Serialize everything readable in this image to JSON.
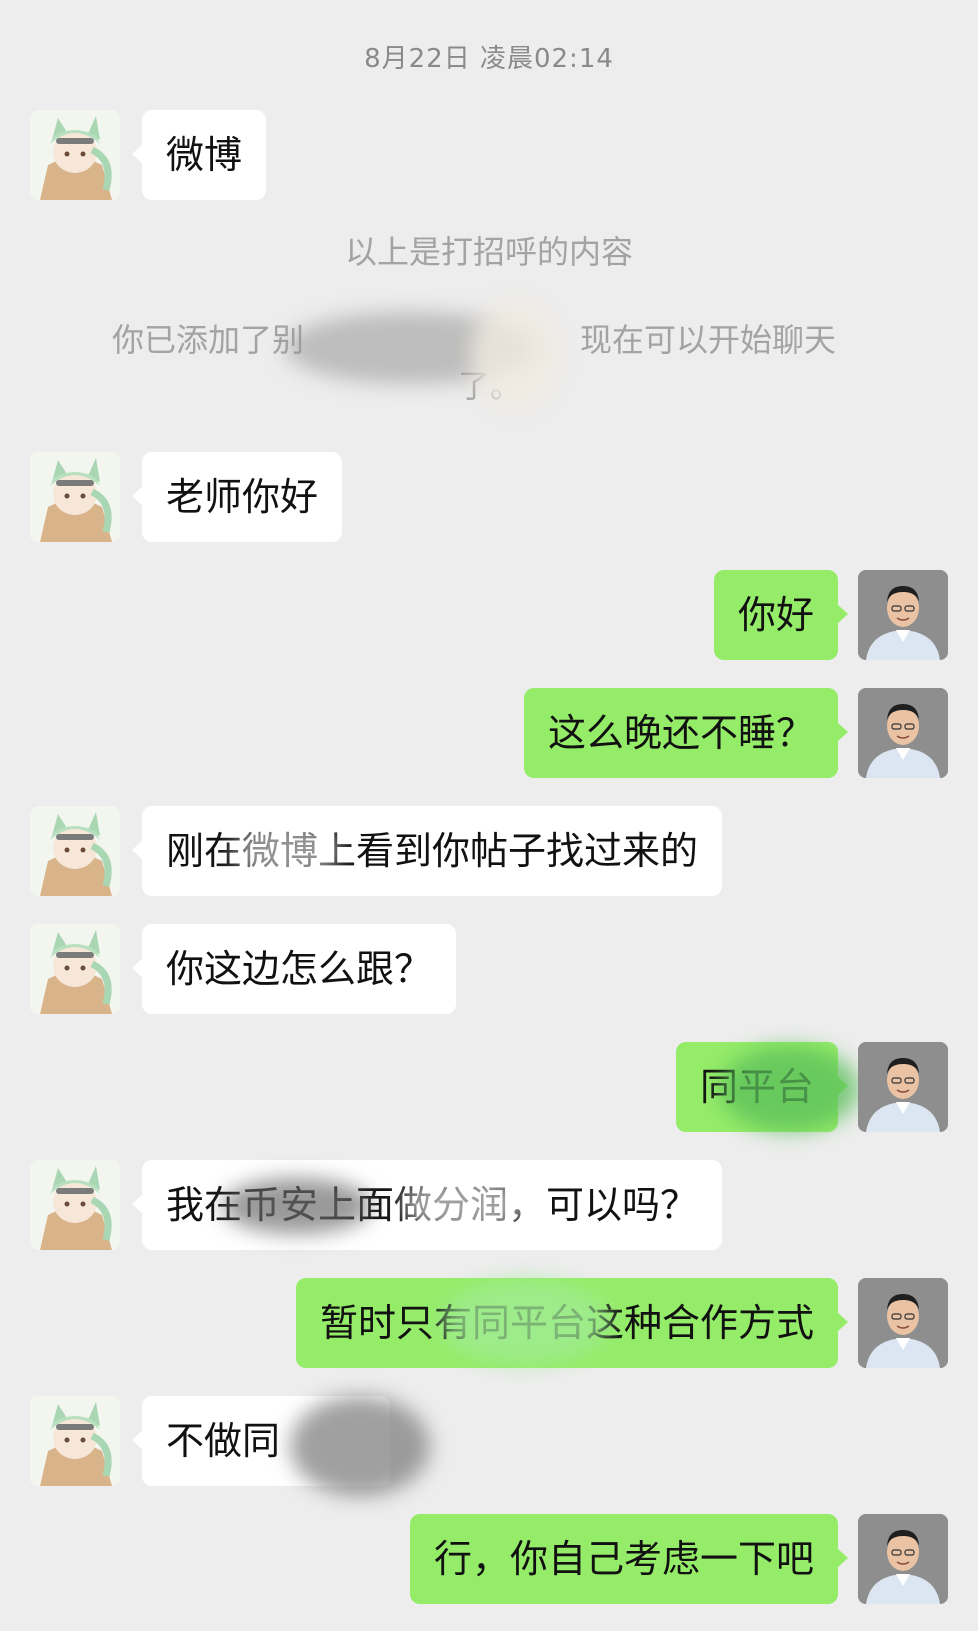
{
  "chat": {
    "timestamp": "8月22日 凌晨02:14",
    "system_notes": {
      "greeting_note": "以上是打招呼的内容",
      "added_note_line1_left": "你已添加了别",
      "added_note_line1_right": "现在可以开始聊天",
      "added_note_line2": "了。"
    },
    "messages": [
      {
        "sender": "other",
        "text": "微博"
      },
      {
        "sender": "other",
        "text": "老师你好"
      },
      {
        "sender": "me",
        "text": "你好"
      },
      {
        "sender": "me",
        "text": "这么晚还不睡？"
      },
      {
        "sender": "other",
        "text": "刚在微博上看到你帖子找过来的"
      },
      {
        "sender": "other",
        "text": "你这边怎么跟？"
      },
      {
        "sender": "me",
        "text": "同平台"
      },
      {
        "sender": "other",
        "text": "我在币安上面做分润，可以吗？"
      },
      {
        "sender": "me",
        "text": "暂时只有同平台这种合作方式"
      },
      {
        "sender": "other",
        "text": "不做同"
      },
      {
        "sender": "me",
        "text": "行，你自己考虑一下吧"
      }
    ]
  },
  "colors": {
    "background": "#ededed",
    "incoming_bubble": "#ffffff",
    "outgoing_bubble": "#95ec69",
    "system_text": "#a3a3a3",
    "timestamp_text": "#8a8a8a"
  },
  "icons": {
    "other_avatar": "anime-character-avatar-icon",
    "my_avatar": "man-portrait-avatar-icon"
  }
}
